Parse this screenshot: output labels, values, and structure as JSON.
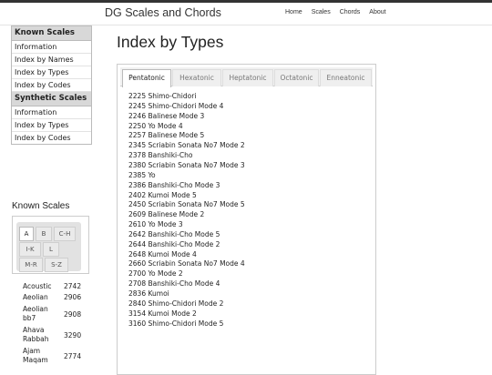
{
  "site_title": "DG Scales and Chords",
  "nav": [
    "Home",
    "Scales",
    "Chords",
    "About"
  ],
  "sidebar": {
    "known_header": "Known Scales",
    "known_items": [
      "Information",
      "Index by Names",
      "Index by Types",
      "Index by Codes"
    ],
    "synthetic_header": "Synthetic Scales",
    "synthetic_items": [
      "Information",
      "Index by Types",
      "Index by Codes"
    ]
  },
  "known_scales": {
    "title": "Known Scales",
    "letter_tabs": [
      "A",
      "B",
      "C-H",
      "I-K",
      "L",
      "M-R",
      "S-Z"
    ],
    "active_tab": "A",
    "rows": [
      {
        "name": "Acoustic",
        "code": "2742"
      },
      {
        "name": "Aeolian",
        "code": "2906"
      },
      {
        "name": "Aeolian bb7",
        "code": "2908"
      },
      {
        "name": "Ahava Rabbah",
        "code": "3290"
      },
      {
        "name": "Ajam Maqam",
        "code": "2774"
      }
    ]
  },
  "main": {
    "title": "Index by Types",
    "tabs": [
      "Pentatonic",
      "Hexatonic",
      "Heptatonic",
      "Octatonic",
      "Enneatonic"
    ],
    "active_tab": "Pentatonic",
    "entries": [
      "2225 Shimo-Chidori",
      "2245 Shimo-Chidori Mode 4",
      "2246 Balinese Mode 3",
      "2250 Yo Mode 4",
      "2257 Balinese Mode 5",
      "2345 Scriabin Sonata No7 Mode 2",
      "2378 Banshiki-Cho",
      "2380 Scriabin Sonata No7 Mode 3",
      "2385 Yo",
      "2386 Banshiki-Cho Mode 3",
      "2402 Kumoi Mode 5",
      "2450 Scriabin Sonata No7 Mode 5",
      "2609 Balinese Mode 2",
      "2610 Yo Mode 3",
      "2642 Banshiki-Cho Mode 5",
      "2644 Banshiki-Cho Mode 2",
      "2648 Kumoi Mode 4",
      "2660 Scriabin Sonata No7 Mode 4",
      "2700 Yo Mode 2",
      "2708 Banshiki-Cho Mode 4",
      "2836 Kumoi",
      "2840 Shimo-Chidori Mode 2",
      "3154 Kumoi Mode 2",
      "3160 Shimo-Chidori Mode 5"
    ]
  }
}
